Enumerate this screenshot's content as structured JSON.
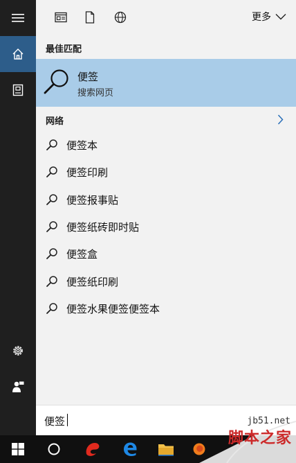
{
  "topbar": {
    "more_label": "更多"
  },
  "best_match": {
    "heading": "最佳匹配",
    "title": "便签",
    "subtitle": "搜索网页"
  },
  "web": {
    "heading": "网络"
  },
  "suggestions": [
    {
      "text": "便签本"
    },
    {
      "text": "便签印刷"
    },
    {
      "text": "便签报事贴"
    },
    {
      "text": "便签纸砖即时贴"
    },
    {
      "text": "便签盒"
    },
    {
      "text": "便签纸印刷"
    },
    {
      "text": "便签水果便签便签本"
    }
  ],
  "search": {
    "value": "便签"
  },
  "watermark": {
    "site": "jb51.net",
    "name": "脚本之家"
  },
  "colors": {
    "rail_bg": "#1f1f1f",
    "rail_active": "#2d5d8a",
    "panel_bg": "#f2f2f2",
    "highlight": "#a9cce8",
    "taskbar_bg": "#101010"
  }
}
